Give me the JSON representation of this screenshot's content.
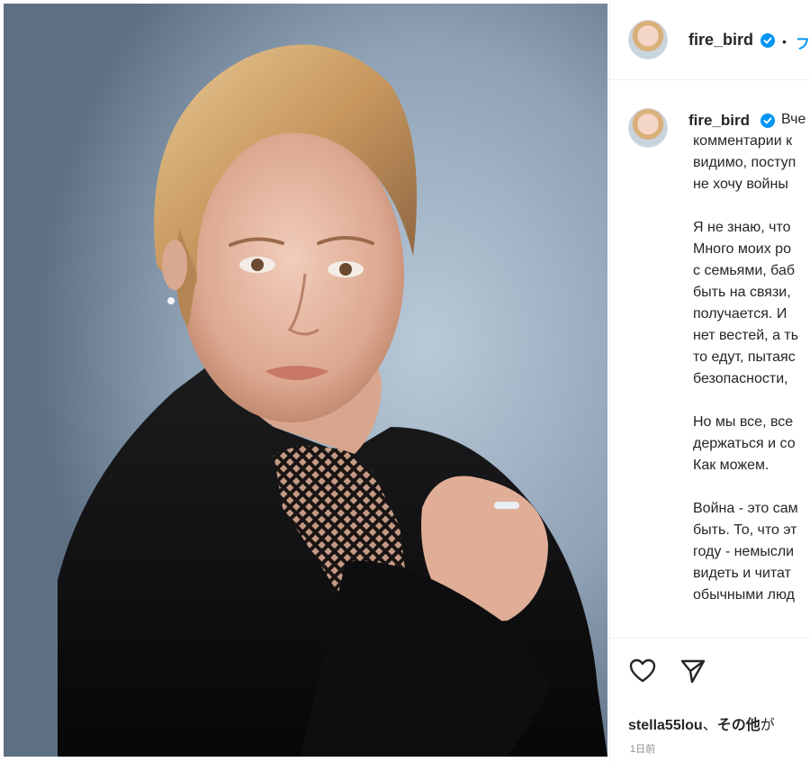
{
  "post": {
    "username": "fire_bird",
    "separator": "•",
    "follow_label": "フ",
    "caption_lines_p1": [
      "Вче",
      "комментарии к",
      "видимо, поступ",
      "не хочу войны"
    ],
    "caption_lines_p2": [
      "Я не знаю, что",
      "Много моих ро",
      "с семьями, баб",
      "быть на связи,",
      "получается. И",
      "нет вестей, а ть",
      "то едут, пытаяс",
      "безопасности,"
    ],
    "caption_lines_p3": [
      "Но мы все, все",
      "держаться и со",
      "Как можем."
    ],
    "caption_lines_p4": [
      "Война - это сам",
      "быть. То, что эт",
      "году - немысли",
      "видеть и читат",
      "обычными люд"
    ],
    "likes_user": "stella55lou",
    "likes_sep": "、",
    "likes_others": "その他",
    "likes_suffix": "が",
    "time_ago": "1日前"
  },
  "icons": {
    "verified": "verified-badge-icon",
    "like": "heart-icon",
    "share": "paper-plane-icon"
  },
  "colors": {
    "accent": "#0095f6",
    "text": "#262626",
    "muted": "#8e8e8e",
    "border": "#efefef"
  }
}
